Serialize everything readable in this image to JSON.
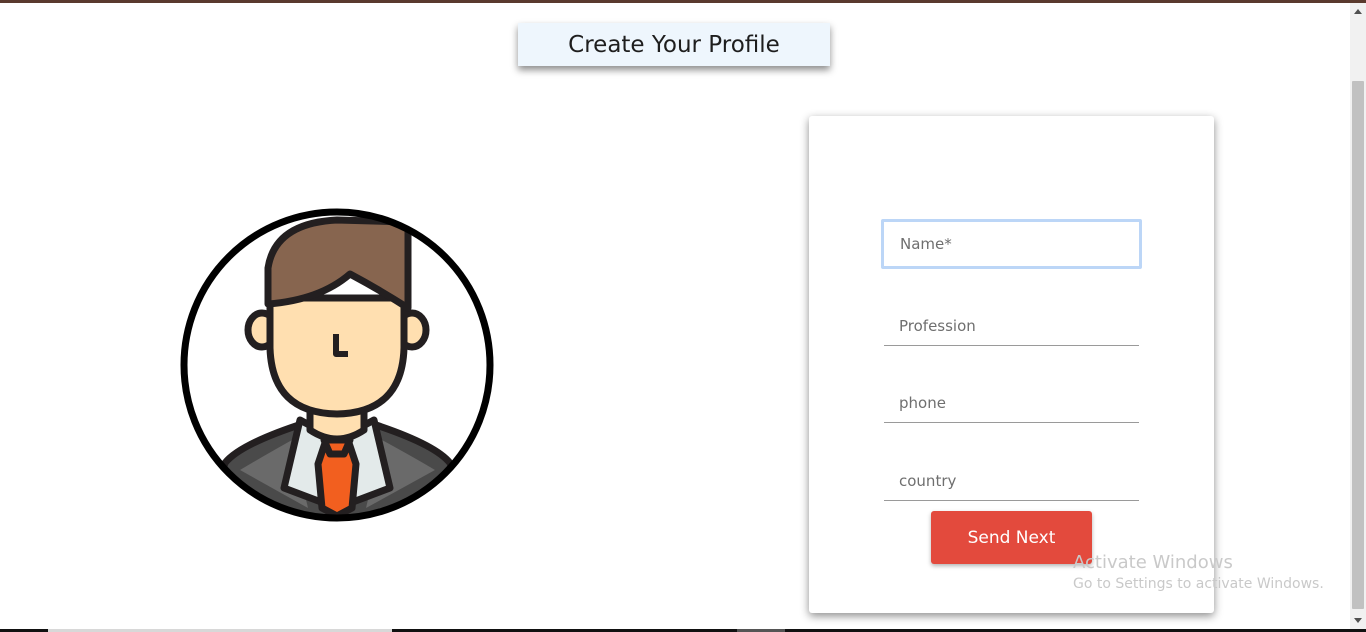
{
  "page": {
    "title": "Create Your Profile"
  },
  "avatar": {
    "icon": "businessman-avatar-icon",
    "colors": {
      "hair": "#87654f",
      "skin": "#ffdfb0",
      "tie": "#f25f1f",
      "suit": "#4a4a4a",
      "shirt": "#e3eaea",
      "outline": "#231f20"
    }
  },
  "form": {
    "name_placeholder": "Name*",
    "name_value": "",
    "profession_placeholder": "Profession",
    "profession_value": "",
    "phone_placeholder": "phone",
    "phone_value": "",
    "country_placeholder": "country",
    "country_value": "",
    "submit_label": "Send Next",
    "accent": "#e34a3d",
    "focus_color": "#bcd6f7"
  },
  "watermark": {
    "line1": "Activate Windows",
    "line2": "Go to Settings to activate Windows."
  }
}
